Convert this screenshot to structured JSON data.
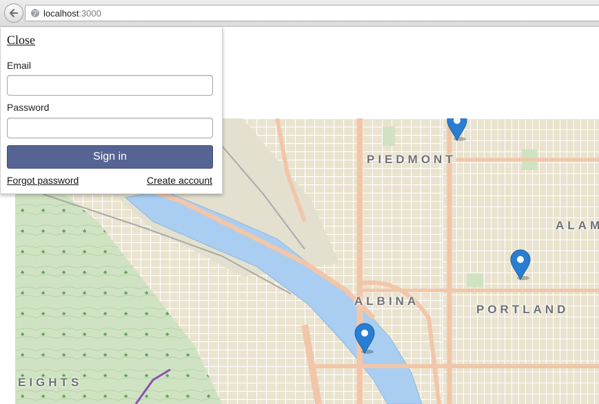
{
  "browser": {
    "url_host": "localhost",
    "url_port": ":3000"
  },
  "login": {
    "close_label": "Close",
    "email_label": "Email",
    "email_value": "",
    "password_label": "Password",
    "password_value": "",
    "signin_label": "Sign in",
    "forgot_label": "Forgot password",
    "create_label": "Create account"
  },
  "map": {
    "district_labels": [
      "PIEDMONT",
      "ALAM",
      "ALBINA",
      "PORTLAND",
      "EIGHTS"
    ],
    "marker_count": 3,
    "colors": {
      "water": "#a9cef2",
      "land": "#e9e3cf",
      "park": "#cfe3c2",
      "major_road": "#f2c6a8",
      "minor_road": "#ffffff",
      "marker": "#2a7ed1"
    }
  }
}
